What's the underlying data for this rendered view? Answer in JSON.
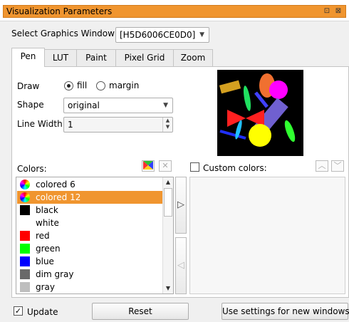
{
  "window": {
    "title": "Visualization Parameters",
    "float_glyph": "⊡",
    "close_glyph": "⊠"
  },
  "graphics_window": {
    "label": "Select Graphics Window",
    "value": "[H5D6006CE0D0]"
  },
  "tabs": [
    {
      "label": "Pen",
      "active": true
    },
    {
      "label": "LUT",
      "active": false
    },
    {
      "label": "Paint",
      "active": false
    },
    {
      "label": "Pixel Grid",
      "active": false
    },
    {
      "label": "Zoom",
      "active": false
    }
  ],
  "pen": {
    "draw_label": "Draw",
    "draw_options": [
      {
        "label": "fill",
        "selected": true
      },
      {
        "label": "margin",
        "selected": false
      }
    ],
    "shape_label": "Shape",
    "shape_value": "original",
    "line_width_label": "Line Width",
    "line_width_value": "1"
  },
  "colors": {
    "label": "Colors:",
    "items": [
      {
        "label": "colored 6",
        "color": "colored-6-icon",
        "selected": false
      },
      {
        "label": "colored 12",
        "color": "colored-12-icon",
        "selected": true
      },
      {
        "label": "black",
        "color": "#000000",
        "selected": false
      },
      {
        "label": "white",
        "color": "#ffffff",
        "selected": false
      },
      {
        "label": "red",
        "color": "#ff0000",
        "selected": false
      },
      {
        "label": "green",
        "color": "#00ff00",
        "selected": false
      },
      {
        "label": "blue",
        "color": "#0000ff",
        "selected": false
      },
      {
        "label": "dim gray",
        "color": "#696969",
        "selected": false
      },
      {
        "label": "gray",
        "color": "#bebebe",
        "selected": false
      }
    ]
  },
  "custom_colors": {
    "label": "Custom colors:",
    "checked": false
  },
  "footer": {
    "update_label": "Update",
    "update_checked": true,
    "reset_label": "Reset",
    "use_settings_label": "Use settings for new windows"
  },
  "accent_color": "#f0952f"
}
